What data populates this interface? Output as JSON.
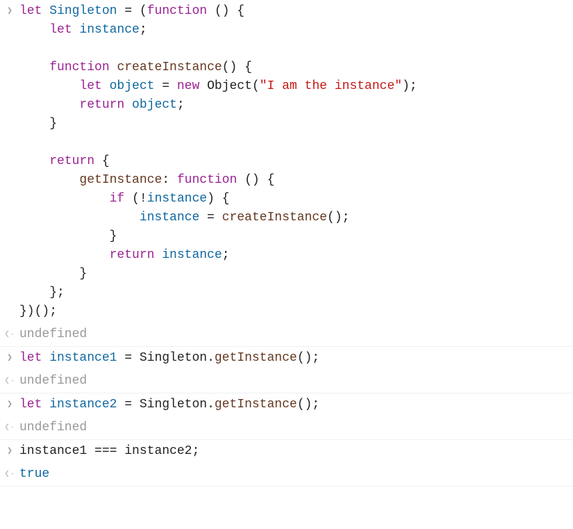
{
  "rows": [
    {
      "type": "input",
      "border": false
    },
    {
      "type": "output",
      "kind": "undef",
      "value": "undefined",
      "border": true
    },
    {
      "type": "input",
      "border": false
    },
    {
      "type": "output",
      "kind": "undef",
      "value": "undefined",
      "border": true
    },
    {
      "type": "input",
      "border": false
    },
    {
      "type": "output",
      "kind": "undef",
      "value": "undefined",
      "border": true
    },
    {
      "type": "input",
      "border": false
    },
    {
      "type": "output",
      "kind": "bool",
      "value": "true",
      "border": true
    }
  ],
  "code": {
    "block1": {
      "l1": {
        "kw_let": "let",
        "name": "Singleton",
        "eq": " = (",
        "kw_fn": "function",
        "rest": " () {"
      },
      "l2": {
        "indent": "    ",
        "kw_let": "let",
        "name": " instance",
        "semi": ";"
      },
      "l3": "",
      "l4": {
        "indent": "    ",
        "kw_fn": "function",
        "name": " createInstance",
        "rest": "() {"
      },
      "l5": {
        "indent": "        ",
        "kw_let": "let",
        "name": " object",
        "eq": " = ",
        "kw_new": "new",
        "ctor": " Object",
        "paren_o": "(",
        "str": "\"I am the instance\"",
        "paren_c": ");"
      },
      "l6": {
        "indent": "        ",
        "kw_ret": "return",
        "name": " object",
        "semi": ";"
      },
      "l7": {
        "indent": "    ",
        "brace": "}"
      },
      "l8": "",
      "l9": {
        "indent": "    ",
        "kw_ret": "return",
        "brace": " {"
      },
      "l10": {
        "indent": "        ",
        "prop": "getInstance",
        "colon": ": ",
        "kw_fn": "function",
        "rest": " () {"
      },
      "l11": {
        "indent": "            ",
        "kw_if": "if",
        "paren_o": " (",
        "bang": "!",
        "name": "instance",
        "paren_c": ") {"
      },
      "l12": {
        "indent": "                ",
        "name": "instance",
        "eq": " = ",
        "call": "createInstance",
        "rest": "();"
      },
      "l13": {
        "indent": "            ",
        "brace": "}"
      },
      "l14": {
        "indent": "            ",
        "kw_ret": "return",
        "name": " instance",
        "semi": ";"
      },
      "l15": {
        "indent": "        ",
        "brace": "}"
      },
      "l16": {
        "indent": "    ",
        "brace": "};"
      },
      "l17": {
        "brace": "})();"
      }
    },
    "block2": {
      "kw_let": "let",
      "name": " instance1",
      "eq": " = ",
      "obj": "Singleton",
      "dot": ".",
      "call": "getInstance",
      "rest": "();"
    },
    "block3": {
      "kw_let": "let",
      "name": " instance2",
      "eq": " = ",
      "obj": "Singleton",
      "dot": ".",
      "call": "getInstance",
      "rest": "();"
    },
    "block4": {
      "name1": "instance1",
      "op": " === ",
      "name2": "instance2",
      "semi": ";"
    }
  },
  "glyphs": {
    "in": "❯",
    "out": "❮·"
  }
}
